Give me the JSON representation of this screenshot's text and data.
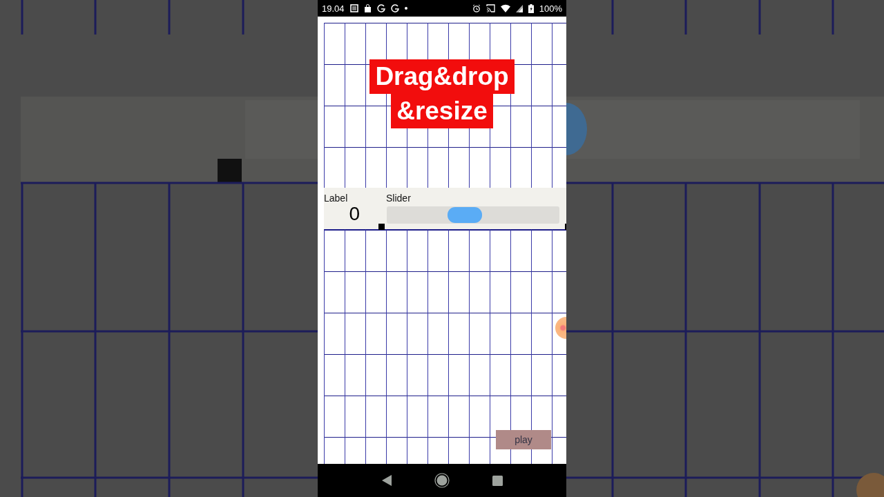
{
  "status_bar": {
    "time": "19.04",
    "battery": "100%"
  },
  "caption": [
    "Drag&drop",
    "&resize"
  ],
  "panel": {
    "label_title": "Label",
    "label_value": "0",
    "slider_title": "Slider",
    "slider": {
      "level": 0.44
    }
  },
  "play_button": {
    "label": "play"
  }
}
